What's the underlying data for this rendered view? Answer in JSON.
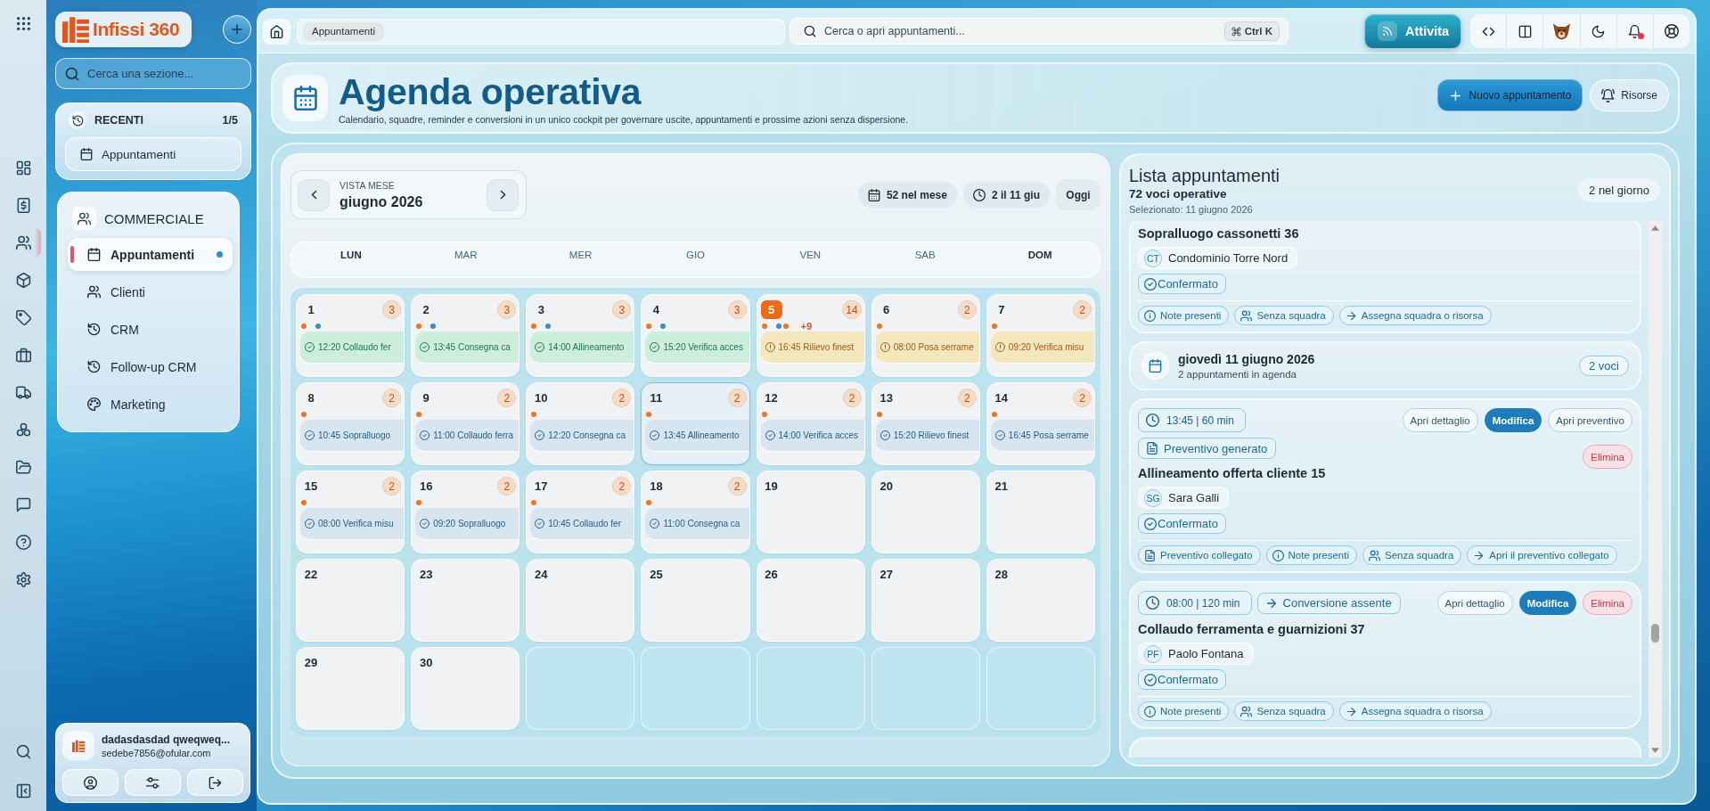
{
  "rail": {
    "items": [
      {
        "selected": false
      },
      {
        "selected": false
      },
      {
        "selected": true
      },
      {
        "selected": false
      },
      {
        "selected": false
      },
      {
        "selected": false
      },
      {
        "selected": false
      },
      {
        "selected": false
      },
      {
        "selected": false
      },
      {
        "selected": false
      },
      {
        "selected": false
      },
      {
        "selected": false
      }
    ]
  },
  "sidebar": {
    "logo": "Infissi 360",
    "search": {
      "placeholder": "Cerca una sezione..."
    },
    "recent": {
      "title": "RECENTI",
      "count": "1/5",
      "items": [
        {
          "label": "Appuntamenti"
        }
      ]
    },
    "section": {
      "title": "COMMERCIALE",
      "items": [
        {
          "label": "Appuntamenti",
          "selected": true
        },
        {
          "label": "Clienti",
          "selected": false
        },
        {
          "label": "CRM",
          "selected": false
        },
        {
          "label": "Follow-up CRM",
          "selected": false
        },
        {
          "label": "Marketing",
          "selected": false
        }
      ]
    },
    "user": {
      "name": "dadasdasdad qweqweq...",
      "email": "sedebe7856@ofular.com"
    }
  },
  "topbar": {
    "breadcrumb": [
      {
        "label": "Appuntamenti"
      }
    ],
    "search": {
      "placeholder": "Cerca o apri appuntamenti...",
      "shortcut": "Ctrl K"
    },
    "activity_button": "Attivita",
    "notifications": {
      "unread": true
    }
  },
  "header": {
    "title": "Agenda operativa",
    "subtitle": "Calendario, squadre, reminder e conversioni in un unico cockpit per governare uscite, appuntamenti e prossime azioni senza dispersione.",
    "buttons": [
      {
        "kind": "primary",
        "label": "Nuovo appuntamento"
      },
      {
        "kind": "secondary",
        "label": "Risorse"
      }
    ]
  },
  "calendar": {
    "view_label": "VISTA MESE",
    "month": "giugno 2026",
    "stats": [
      {
        "kind": "month",
        "label": "52 nel mese"
      },
      {
        "kind": "day",
        "label": "2 il 11 giu"
      }
    ],
    "today_button": "Oggi",
    "weekdays": [
      {
        "label": "LUN",
        "highlighted": true
      },
      {
        "label": "MAR",
        "highlighted": false
      },
      {
        "label": "MER",
        "highlighted": false
      },
      {
        "label": "GIO",
        "highlighted": false
      },
      {
        "label": "VEN",
        "highlighted": false
      },
      {
        "label": "SAB",
        "highlighted": false
      },
      {
        "label": "DOM",
        "highlighted": true
      }
    ],
    "days": [
      {
        "day": "1",
        "count": "3",
        "today": false,
        "selected": false,
        "dots": [
          {
            "color": "#f07522"
          },
          {
            "color": "#3a8cc6"
          }
        ],
        "events": [
          {
            "kind": "success",
            "text": "12:20 Collaudo fer"
          }
        ]
      },
      {
        "day": "2",
        "count": "3",
        "today": false,
        "selected": false,
        "dots": [
          {
            "color": "#f07522"
          },
          {
            "color": "#3a8cc6"
          }
        ],
        "events": [
          {
            "kind": "success",
            "text": "13:45 Consegna ca"
          }
        ]
      },
      {
        "day": "3",
        "count": "3",
        "today": false,
        "selected": false,
        "dots": [
          {
            "color": "#f07522"
          },
          {
            "color": "#3a8cc6"
          }
        ],
        "events": [
          {
            "kind": "success",
            "text": "14:00 Allineamento"
          }
        ]
      },
      {
        "day": "4",
        "count": "3",
        "today": false,
        "selected": false,
        "dots": [
          {
            "color": "#f07522"
          },
          {
            "color": "#3a8cc6"
          }
        ],
        "events": [
          {
            "kind": "success",
            "text": "15:20 Verifica acces"
          }
        ]
      },
      {
        "day": "5",
        "count": "14",
        "today": true,
        "selected": false,
        "dots": [
          {
            "color": "#f07522"
          },
          {
            "color": "#3a8cc6"
          },
          {
            "color": "#f07522"
          }
        ],
        "more": "+9",
        "events": [
          {
            "kind": "warning",
            "text": "16:45 Rilievo finest"
          }
        ]
      },
      {
        "day": "6",
        "count": "2",
        "today": false,
        "selected": false,
        "dots": [
          {
            "color": "#f07522"
          }
        ],
        "events": [
          {
            "kind": "warning",
            "text": "08:00 Posa serrame"
          }
        ]
      },
      {
        "day": "7",
        "count": "2",
        "today": false,
        "selected": false,
        "dots": [
          {
            "color": "#f07522"
          }
        ],
        "events": [
          {
            "kind": "warning",
            "text": "09:20 Verifica misu"
          }
        ]
      },
      {
        "day": "8",
        "count": "2",
        "today": false,
        "selected": false,
        "dots": [
          {
            "color": "#f07522"
          }
        ],
        "events": [
          {
            "kind": "info",
            "text": "10:45 Sopralluogo"
          }
        ]
      },
      {
        "day": "9",
        "count": "2",
        "today": false,
        "selected": false,
        "dots": [
          {
            "color": "#f07522"
          }
        ],
        "events": [
          {
            "kind": "info",
            "text": "11:00 Collaudo ferra"
          }
        ]
      },
      {
        "day": "10",
        "count": "2",
        "today": false,
        "selected": false,
        "dots": [
          {
            "color": "#f07522"
          }
        ],
        "events": [
          {
            "kind": "info",
            "text": "12:20 Consegna ca"
          }
        ]
      },
      {
        "day": "11",
        "count": "2",
        "today": false,
        "selected": true,
        "dots": [
          {
            "color": "#f07522"
          }
        ],
        "events": [
          {
            "kind": "info",
            "text": "13:45 Allineamento"
          }
        ]
      },
      {
        "day": "12",
        "count": "2",
        "today": false,
        "selected": false,
        "dots": [
          {
            "color": "#f07522"
          }
        ],
        "events": [
          {
            "kind": "info",
            "text": "14:00 Verifica acces"
          }
        ]
      },
      {
        "day": "13",
        "count": "2",
        "today": false,
        "selected": false,
        "dots": [
          {
            "color": "#f07522"
          }
        ],
        "events": [
          {
            "kind": "info",
            "text": "15:20 Rilievo finest"
          }
        ]
      },
      {
        "day": "14",
        "count": "2",
        "today": false,
        "selected": false,
        "dots": [
          {
            "color": "#f07522"
          }
        ],
        "events": [
          {
            "kind": "info",
            "text": "16:45 Posa serrame"
          }
        ]
      },
      {
        "day": "15",
        "count": "2",
        "today": false,
        "selected": false,
        "dots": [
          {
            "color": "#f07522"
          }
        ],
        "events": [
          {
            "kind": "info",
            "text": "08:00 Verifica misu"
          }
        ]
      },
      {
        "day": "16",
        "count": "2",
        "today": false,
        "selected": false,
        "dots": [
          {
            "color": "#f07522"
          }
        ],
        "events": [
          {
            "kind": "info",
            "text": "09:20 Sopralluogo"
          }
        ]
      },
      {
        "day": "17",
        "count": "2",
        "today": false,
        "selected": false,
        "dots": [
          {
            "color": "#f07522"
          }
        ],
        "events": [
          {
            "kind": "info",
            "text": "10:45 Collaudo fer"
          }
        ]
      },
      {
        "day": "18",
        "count": "2",
        "today": false,
        "selected": false,
        "dots": [
          {
            "color": "#f07522"
          }
        ],
        "events": [
          {
            "kind": "info",
            "text": "11:00 Consegna ca"
          }
        ]
      },
      {
        "day": "19",
        "today": false,
        "selected": false
      },
      {
        "day": "20",
        "today": false,
        "selected": false
      },
      {
        "day": "21",
        "today": false,
        "selected": false
      },
      {
        "day": "22",
        "today": false,
        "selected": false
      },
      {
        "day": "23",
        "today": false,
        "selected": false
      },
      {
        "day": "24",
        "today": false,
        "selected": false
      },
      {
        "day": "25",
        "today": false,
        "selected": false
      },
      {
        "day": "26",
        "today": false,
        "selected": false
      },
      {
        "day": "27",
        "today": false,
        "selected": false
      },
      {
        "day": "28",
        "today": false,
        "selected": false
      },
      {
        "day": "29",
        "today": false,
        "selected": false
      },
      {
        "day": "30",
        "today": false,
        "selected": false
      }
    ]
  },
  "list": {
    "title": "Lista appuntamenti",
    "count": "72 voci operative",
    "selection": "Selezionato: 11 giugno 2026",
    "day_badge": "2 nel giorno",
    "entries": [
      {
        "kind": "appointment",
        "title": "Sopralluogo cassonetti 36",
        "client": {
          "initials": "CT",
          "name": "Condominio Torre Nord"
        },
        "status": "Confermato",
        "tags": [
          {
            "kind": "notes",
            "label": "Note presenti"
          },
          {
            "kind": "team",
            "label": "Senza squadra"
          },
          {
            "kind": "action",
            "label": "Assegna squadra o risorsa"
          }
        ]
      },
      {
        "kind": "day",
        "title": "giovedì 11 giugno 2026",
        "subtitle": "2 appuntamenti in agenda",
        "badge": "2 voci"
      },
      {
        "kind": "appointment",
        "time": "13:45 | 60 min",
        "chips": [
          {
            "kind": "quote",
            "label": "Preventivo generato"
          }
        ],
        "actions": [
          {
            "kind": "outline",
            "label": "Apri dettaglio"
          },
          {
            "kind": "primary",
            "label": "Modifica"
          },
          {
            "kind": "outline",
            "label": "Apri preventivo"
          },
          {
            "kind": "danger",
            "label": "Elimina"
          }
        ],
        "title": "Allineamento offerta cliente 15",
        "client": {
          "initials": "SG",
          "name": "Sara Galli"
        },
        "status": "Confermato",
        "tags": [
          {
            "kind": "quote",
            "label": "Preventivo collegato"
          },
          {
            "kind": "notes",
            "label": "Note presenti"
          },
          {
            "kind": "team",
            "label": "Senza squadra"
          },
          {
            "kind": "action",
            "label": "Apri il preventivo collegato"
          }
        ]
      },
      {
        "kind": "appointment",
        "time": "08:00 | 120 min",
        "chips": [
          {
            "kind": "conversion",
            "label": "Conversione assente"
          }
        ],
        "actions": [
          {
            "kind": "outline",
            "label": "Apri dettaglio"
          },
          {
            "kind": "primary",
            "label": "Modifica"
          },
          {
            "kind": "danger",
            "label": "Elimina"
          }
        ],
        "title": "Collaudo ferramenta e guarnizioni 37",
        "client": {
          "initials": "PF",
          "name": "Paolo Fontana"
        },
        "status": "Confermato",
        "tags": [
          {
            "kind": "notes",
            "label": "Note presenti"
          },
          {
            "kind": "team",
            "label": "Senza squadra"
          },
          {
            "kind": "action",
            "label": "Assegna squadra o risorsa"
          }
        ]
      },
      {
        "kind": "day"
      }
    ]
  }
}
